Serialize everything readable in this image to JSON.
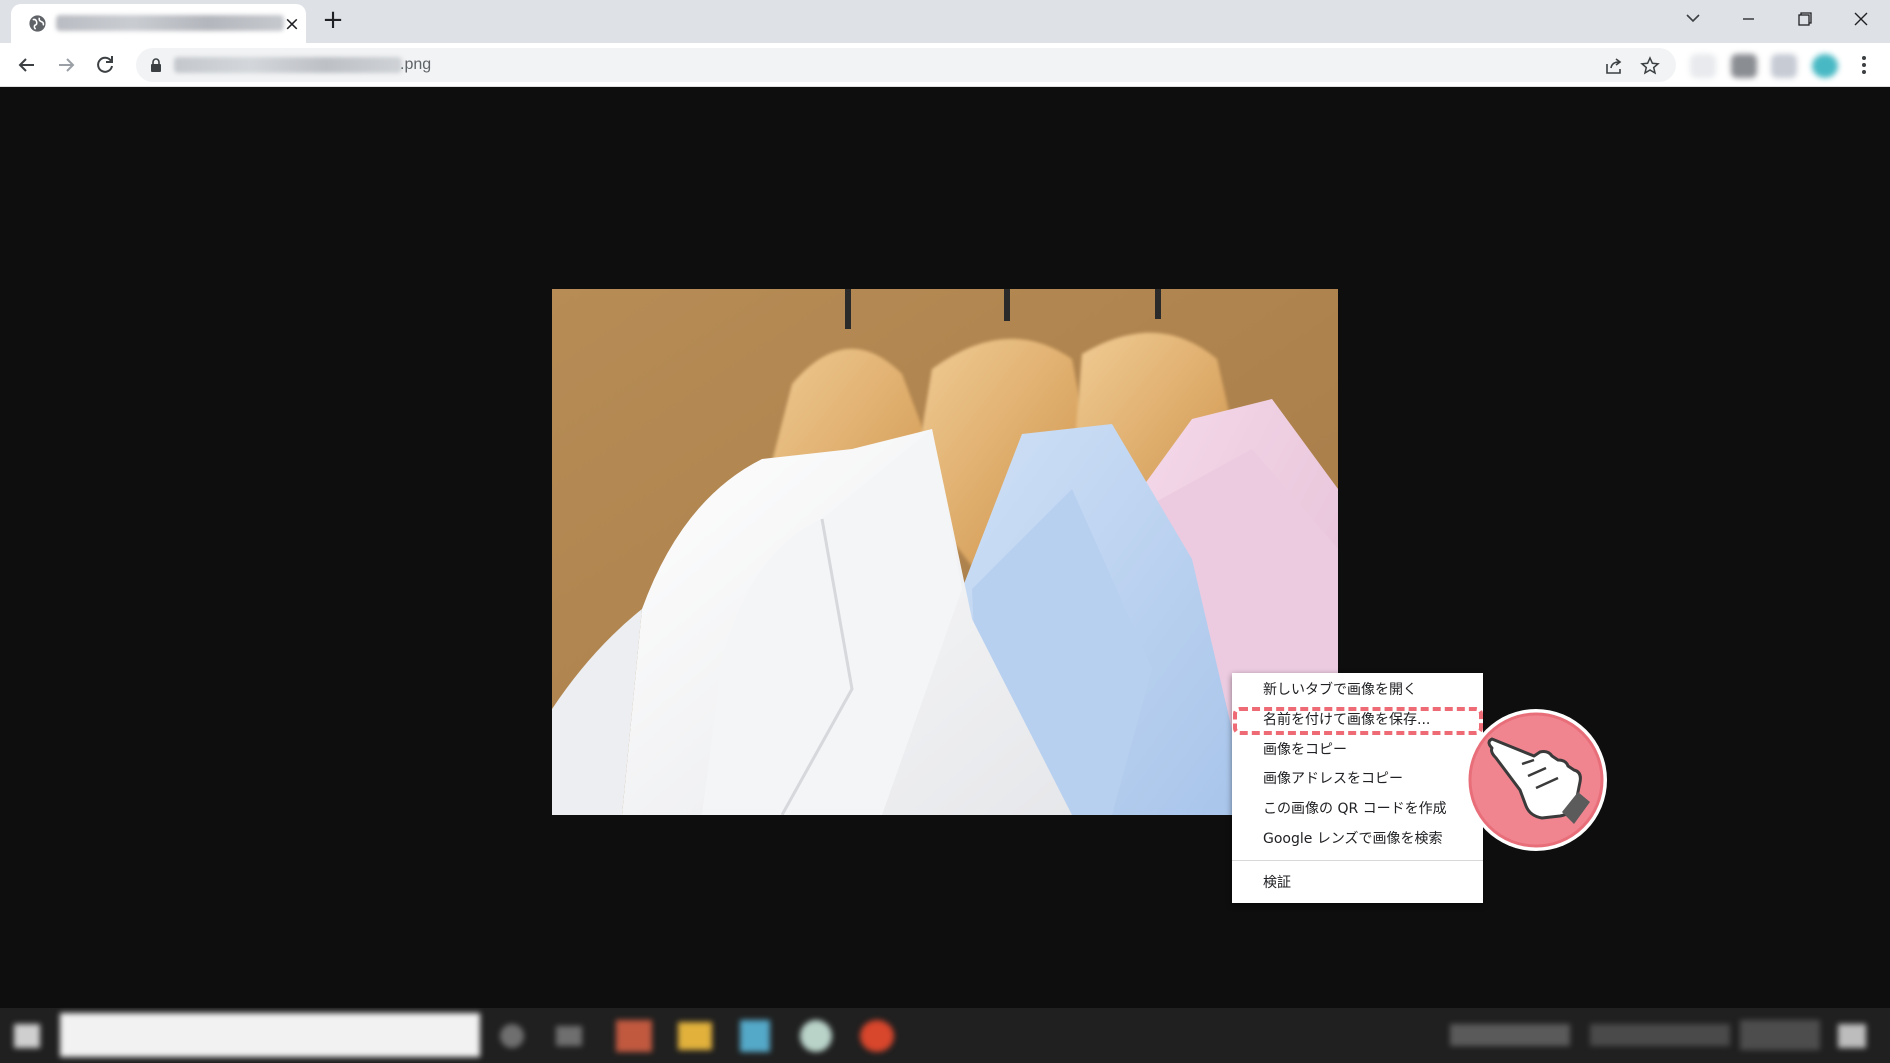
{
  "browser": {
    "new_tab_symbol": "+",
    "tab_close_symbol": "×",
    "url_suffix": ".png"
  },
  "context_menu": {
    "items": [
      "新しいタブで画像を開く",
      "名前を付けて画像を保存...",
      "画像をコピー",
      "画像アドレスをコピー",
      "この画像の QR コードを作成",
      "Google レンズで画像を検索"
    ],
    "inspect": "検証",
    "highlighted_index": 1
  },
  "colors": {
    "highlight": "#ee6b75",
    "callout_fill": "#f08590",
    "viewer_background": "#0e0e0e"
  },
  "icons": {
    "tab_favicon": "globe-icon",
    "back": "arrow-left-icon",
    "forward": "arrow-right-icon",
    "reload": "reload-icon",
    "secure": "lock-icon",
    "share": "share-icon",
    "bookmark": "star-icon",
    "menu": "kebab-menu-icon",
    "pointer": "pointing-hand-icon"
  }
}
